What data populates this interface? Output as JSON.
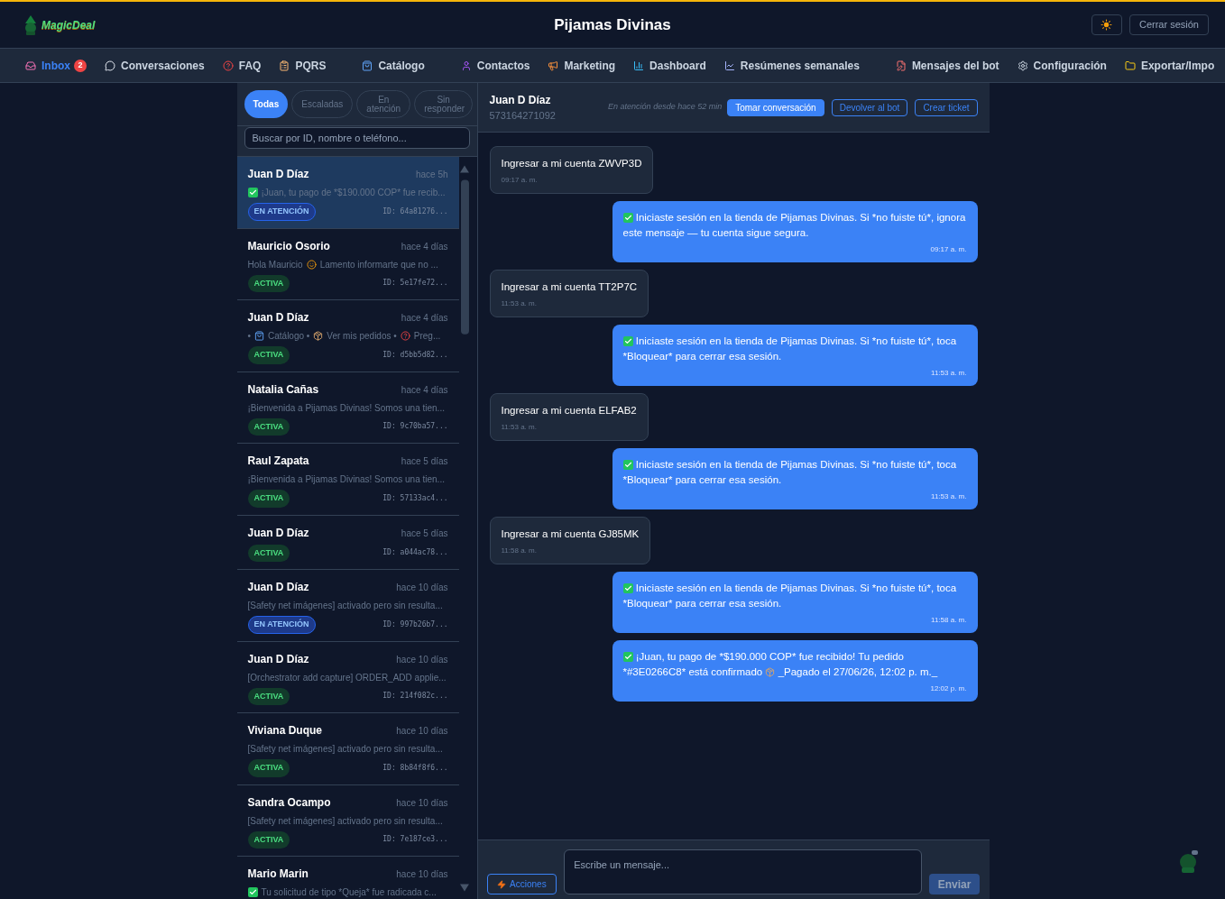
{
  "header": {
    "logo_text": "MagicDeal",
    "title": "Pijamas Divinas",
    "logout": "Cerrar sesión"
  },
  "nav": [
    [
      {
        "label": "Inbox",
        "kind": "inbox",
        "selected": true,
        "badge": "2"
      },
      {
        "label": "Conversaciones",
        "kind": "chat",
        "selected": false
      },
      {
        "label": "FAQ",
        "kind": "question",
        "selected": false
      },
      {
        "label": "PQRS",
        "kind": "clipboard",
        "selected": false
      }
    ],
    [
      {
        "label": "Catálogo",
        "kind": "bag",
        "selected": false
      }
    ],
    [
      {
        "label": "Contactos",
        "kind": "user",
        "selected": false
      },
      {
        "label": "Marketing",
        "kind": "megaphone",
        "selected": false
      },
      {
        "label": "Dashboard",
        "kind": "bars",
        "selected": false
      },
      {
        "label": "Resúmenes semanales",
        "kind": "trend",
        "selected": false
      }
    ],
    [
      {
        "label": "Mensajes del bot",
        "kind": "doc",
        "selected": false
      },
      {
        "label": "Configuración",
        "kind": "gear",
        "selected": false
      },
      {
        "label": "Exportar/Impo",
        "kind": "folder",
        "selected": false
      }
    ]
  ],
  "filters": [
    {
      "label": "Todas",
      "selected": true
    },
    {
      "label": "Escaladas",
      "selected": false
    },
    {
      "label": "En atención",
      "selected": false
    },
    {
      "label": "Sin responder",
      "selected": false
    }
  ],
  "search": {
    "placeholder": "Buscar por ID, nombre o teléfono..."
  },
  "conversations": [
    {
      "name": "Juan D Díaz",
      "time": "hace 5h",
      "preview": [
        {
          "kind": "check"
        },
        {
          "kind": "text",
          "text": "¡Juan, tu pago de *$190.000 COP* fue recib..."
        }
      ],
      "status": {
        "kind": "attention",
        "label": "EN ATENCIÓN"
      },
      "id": "ID: 64a81276...",
      "selected": true
    },
    {
      "name": "Mauricio Osorio",
      "time": "hace 4 días",
      "preview": [
        {
          "kind": "text",
          "text": "Hola Mauricio"
        },
        {
          "kind": "smile"
        },
        {
          "kind": "text",
          "text": "Lamento informarte que no ..."
        }
      ],
      "status": {
        "kind": "active",
        "label": "ACTIVA"
      },
      "id": "ID: 5e17fe72...",
      "selected": false
    },
    {
      "name": "Juan D Díaz",
      "time": "hace 4 días",
      "preview": [
        {
          "kind": "text",
          "text": "•"
        },
        {
          "kind": "bag"
        },
        {
          "kind": "text",
          "text": "Catálogo •"
        },
        {
          "kind": "box"
        },
        {
          "kind": "text",
          "text": "Ver mis pedidos •"
        },
        {
          "kind": "question"
        },
        {
          "kind": "text",
          "text": "Preg..."
        }
      ],
      "status": {
        "kind": "active",
        "label": "ACTIVA"
      },
      "id": "ID: d5bb5d82...",
      "selected": false
    },
    {
      "name": "Natalia Cañas",
      "time": "hace 4 días",
      "preview": [
        {
          "kind": "text",
          "text": "¡Bienvenida a Pijamas Divinas! Somos una tien..."
        }
      ],
      "status": {
        "kind": "active",
        "label": "ACTIVA"
      },
      "id": "ID: 9c70ba57...",
      "selected": false
    },
    {
      "name": "Raul Zapata",
      "time": "hace 5 días",
      "preview": [
        {
          "kind": "text",
          "text": "¡Bienvenida a Pijamas Divinas! Somos una tien..."
        }
      ],
      "status": {
        "kind": "active",
        "label": "ACTIVA"
      },
      "id": "ID: 57133ac4...",
      "selected": false
    },
    {
      "name": "Juan D Díaz",
      "time": "hace 5 días",
      "status": {
        "kind": "active",
        "label": "ACTIVA"
      },
      "id": "ID: a044ac78...",
      "selected": false
    },
    {
      "name": "Juan D Díaz",
      "time": "hace 10 días",
      "preview": [
        {
          "kind": "text",
          "text": "[Safety net imágenes] activado pero sin resulta..."
        }
      ],
      "status": {
        "kind": "attention",
        "label": "EN ATENCIÓN"
      },
      "id": "ID: 997b26b7...",
      "selected": false
    },
    {
      "name": "Juan D Díaz",
      "time": "hace 10 días",
      "preview": [
        {
          "kind": "text",
          "text": "[Orchestrator add capture] ORDER_ADD applie..."
        }
      ],
      "status": {
        "kind": "active",
        "label": "ACTIVA"
      },
      "id": "ID: 214f082c...",
      "selected": false
    },
    {
      "name": "Viviana Duque",
      "time": "hace 10 días",
      "preview": [
        {
          "kind": "text",
          "text": "[Safety net imágenes] activado pero sin resulta..."
        }
      ],
      "status": {
        "kind": "active",
        "label": "ACTIVA"
      },
      "id": "ID: 8b84f8f6...",
      "selected": false
    },
    {
      "name": "Sandra Ocampo",
      "time": "hace 10 días",
      "preview": [
        {
          "kind": "text",
          "text": "[Safety net imágenes] activado pero sin resulta..."
        }
      ],
      "status": {
        "kind": "active",
        "label": "ACTIVA"
      },
      "id": "ID: 7e187ce3...",
      "selected": false
    },
    {
      "name": "Mario Marin",
      "time": "hace 10 días",
      "preview": [
        {
          "kind": "check"
        },
        {
          "kind": "text",
          "text": "Tu solicitud de tipo *Queja* fue radicada c..."
        }
      ],
      "selected": false
    }
  ],
  "chat": {
    "name": "Juan D Díaz",
    "phone": "573164271092",
    "note": "En atención desde hace 52 min",
    "actions": [
      {
        "label": "Tomar conversación",
        "kind": "primary"
      },
      {
        "label": "Devolver al bot",
        "kind": "outline"
      },
      {
        "label": "Crear ticket",
        "kind": "outline"
      }
    ],
    "messages": [
      {
        "kind": "incoming",
        "parts": [
          {
            "kind": "text",
            "text": "Ingresar a mi cuenta ZWVP3D"
          }
        ],
        "time": "09:17 a. m."
      },
      {
        "kind": "outgoing",
        "parts": [
          {
            "kind": "check"
          },
          {
            "kind": "text",
            "text": "Iniciaste sesión en la tienda de Pijamas Divinas. Si *no fuiste tú*, ignora este mensaje — tu cuenta sigue segura."
          }
        ],
        "time": "09:17 a. m."
      },
      {
        "kind": "incoming",
        "parts": [
          {
            "kind": "text",
            "text": "Ingresar a mi cuenta TT2P7C"
          }
        ],
        "time": "11:53 a. m."
      },
      {
        "kind": "outgoing",
        "parts": [
          {
            "kind": "check"
          },
          {
            "kind": "text",
            "text": "Iniciaste sesión en la tienda de Pijamas Divinas. Si *no fuiste tú*, toca *Bloquear* para cerrar esa sesión."
          }
        ],
        "time": "11:53 a. m."
      },
      {
        "kind": "incoming",
        "parts": [
          {
            "kind": "text",
            "text": "Ingresar a mi cuenta ELFAB2"
          }
        ],
        "time": "11:53 a. m."
      },
      {
        "kind": "outgoing",
        "parts": [
          {
            "kind": "check"
          },
          {
            "kind": "text",
            "text": "Iniciaste sesión en la tienda de Pijamas Divinas. Si *no fuiste tú*, toca *Bloquear* para cerrar esa sesión."
          }
        ],
        "time": "11:53 a. m."
      },
      {
        "kind": "incoming",
        "parts": [
          {
            "kind": "text",
            "text": "Ingresar a mi cuenta GJ85MK"
          }
        ],
        "time": "11:58 a. m."
      },
      {
        "kind": "outgoing",
        "parts": [
          {
            "kind": "check"
          },
          {
            "kind": "text",
            "text": "Iniciaste sesión en la tienda de Pijamas Divinas. Si *no fuiste tú*, toca *Bloquear* para cerrar esa sesión."
          }
        ],
        "time": "11:58 a. m."
      },
      {
        "kind": "outgoing",
        "parts": [
          {
            "kind": "check"
          },
          {
            "kind": "text",
            "text": "¡Juan, tu pago de *$190.000 COP* fue recibido! Tu pedido *#3E0266C8* está confirmado"
          },
          {
            "kind": "box"
          },
          {
            "kind": "text",
            "text": "_Pagado el 27/06/26, 12:02 p. m._"
          }
        ],
        "time": "12:02 p. m."
      }
    ]
  },
  "composer": {
    "actions": "Acciones",
    "placeholder": "Escribe un mensaje...",
    "send": "Enviar"
  }
}
